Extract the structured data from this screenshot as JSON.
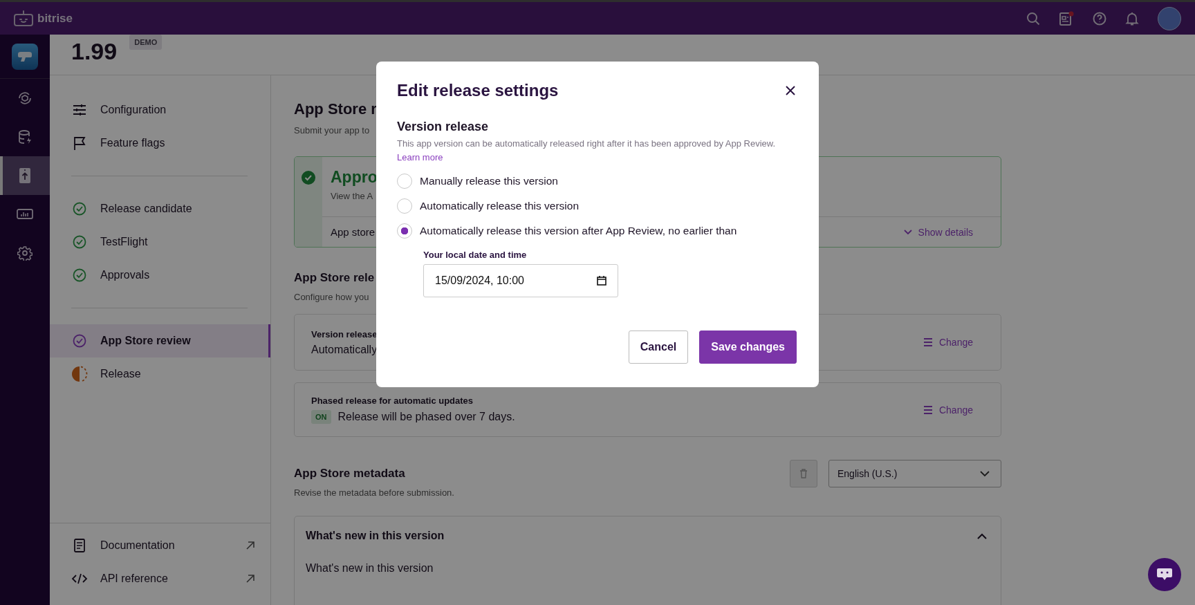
{
  "top_bar": {
    "logo_text": "bitrise",
    "has_unread_changelog": true
  },
  "rail": {
    "items": [
      {
        "kind": "builds",
        "selected": false
      },
      {
        "kind": "cache",
        "selected": false
      },
      {
        "kind": "release",
        "selected": true
      },
      {
        "kind": "insights",
        "selected": false
      },
      {
        "kind": "settings",
        "selected": false
      }
    ]
  },
  "header": {
    "version": "1.99",
    "badge": "DEMO"
  },
  "sidebar": {
    "groups": [
      [
        {
          "label": "Configuration",
          "kind": "sliders",
          "selected": false
        },
        {
          "label": "Feature flags",
          "kind": "flag",
          "selected": false
        }
      ],
      [
        {
          "label": "Release candidate",
          "kind": "done",
          "selected": false
        },
        {
          "label": "TestFlight",
          "kind": "done",
          "selected": false
        },
        {
          "label": "Approvals",
          "kind": "done",
          "selected": false
        }
      ],
      [
        {
          "label": "App Store review",
          "kind": "current",
          "selected": true
        },
        {
          "label": "Release",
          "kind": "partial",
          "selected": false
        }
      ]
    ],
    "footer": [
      {
        "label": "Documentation",
        "kind": "document"
      },
      {
        "label": "API reference",
        "kind": "code"
      }
    ]
  },
  "content": {
    "title": "App Store r",
    "subtitle": "Submit your app to",
    "status_card": {
      "title": "Appro",
      "text": "View the A",
      "row_label": "App store",
      "toggle": "Show details"
    },
    "settings_title": "App Store rele",
    "settings_subtitle": "Configure how you",
    "settings_cards": [
      {
        "label": "Version release",
        "value": "Automatically",
        "change": "Change"
      },
      {
        "label": "Phased release for automatic updates",
        "badge": "ON",
        "value": "Release will be phased over 7 days.",
        "change": "Change"
      }
    ],
    "metadata": {
      "title": "App Store metadata",
      "subtitle": "Revise the metadata before submission.",
      "language": "English (U.S.)",
      "section": {
        "title": "What's new in this version",
        "expanded": true,
        "field_label": "What's new in this version"
      }
    }
  },
  "modal": {
    "title": "Edit release settings",
    "section_title": "Version release",
    "description": "This app version can be automatically released right after it has been approved by App Review.",
    "link": "Learn more",
    "options": [
      {
        "label": "Manually release this version",
        "selected": false
      },
      {
        "label": "Automatically release this version",
        "selected": false
      },
      {
        "label": "Automatically release this version after App Review, no earlier than",
        "selected": true
      }
    ],
    "date_label": "Your local date and time",
    "date_value": "15/09/2024, 10:00",
    "buttons": [
      {
        "label": "Cancel",
        "kind": "secondary"
      },
      {
        "label": "Save changes",
        "kind": "primary"
      }
    ]
  }
}
